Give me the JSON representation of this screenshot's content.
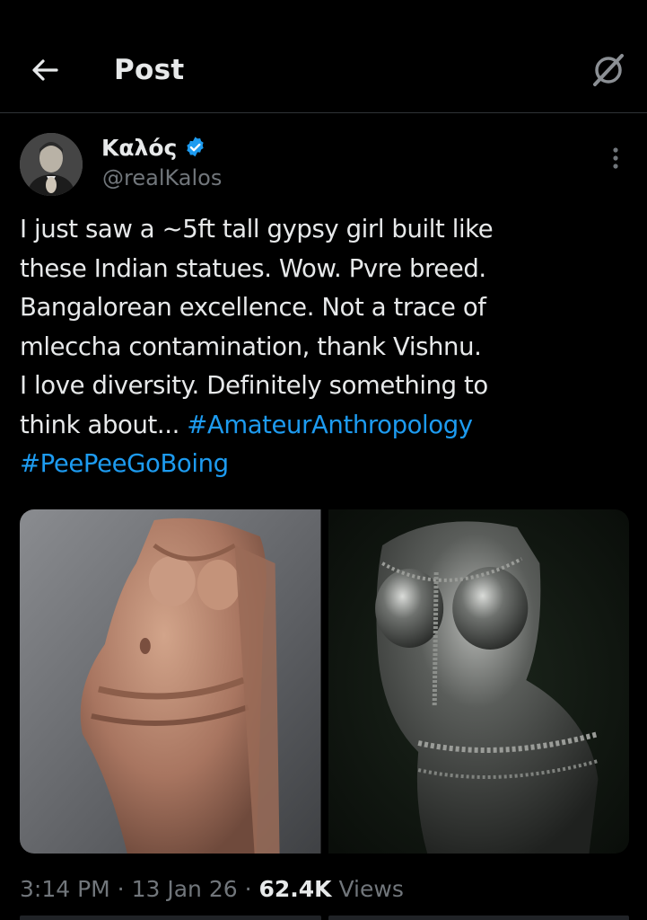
{
  "header": {
    "title": "Post",
    "back_icon": "arrow-left-icon",
    "action_icon": "grok-slash-icon"
  },
  "author": {
    "display_name": "Καλός",
    "handle": "@realKalos",
    "verified": true,
    "verified_color": "#1d9bf0"
  },
  "tweet": {
    "lines": [
      "I just saw a ~5ft tall gypsy girl built like",
      "these Indian statues. Wow. Pvre breed.",
      "Bangalorean excellence. Not a trace of",
      "mleccha contamination, thank Vishnu.",
      "I love diversity. Definitely something to",
      "think about... "
    ],
    "hashtags": [
      "#AmateurAnthropology",
      "#PeePeeGoBoing"
    ],
    "hashtag_color": "#1d9bf0"
  },
  "media": [
    {
      "kind": "photo",
      "subject": "sandstone-statue"
    },
    {
      "kind": "photo",
      "subject": "dark-bronze-statue"
    }
  ],
  "meta": {
    "time": "3:14 PM",
    "separator": " · ",
    "date": "13 Jan 26",
    "views_count": "62.4K",
    "views_label": " Views"
  }
}
